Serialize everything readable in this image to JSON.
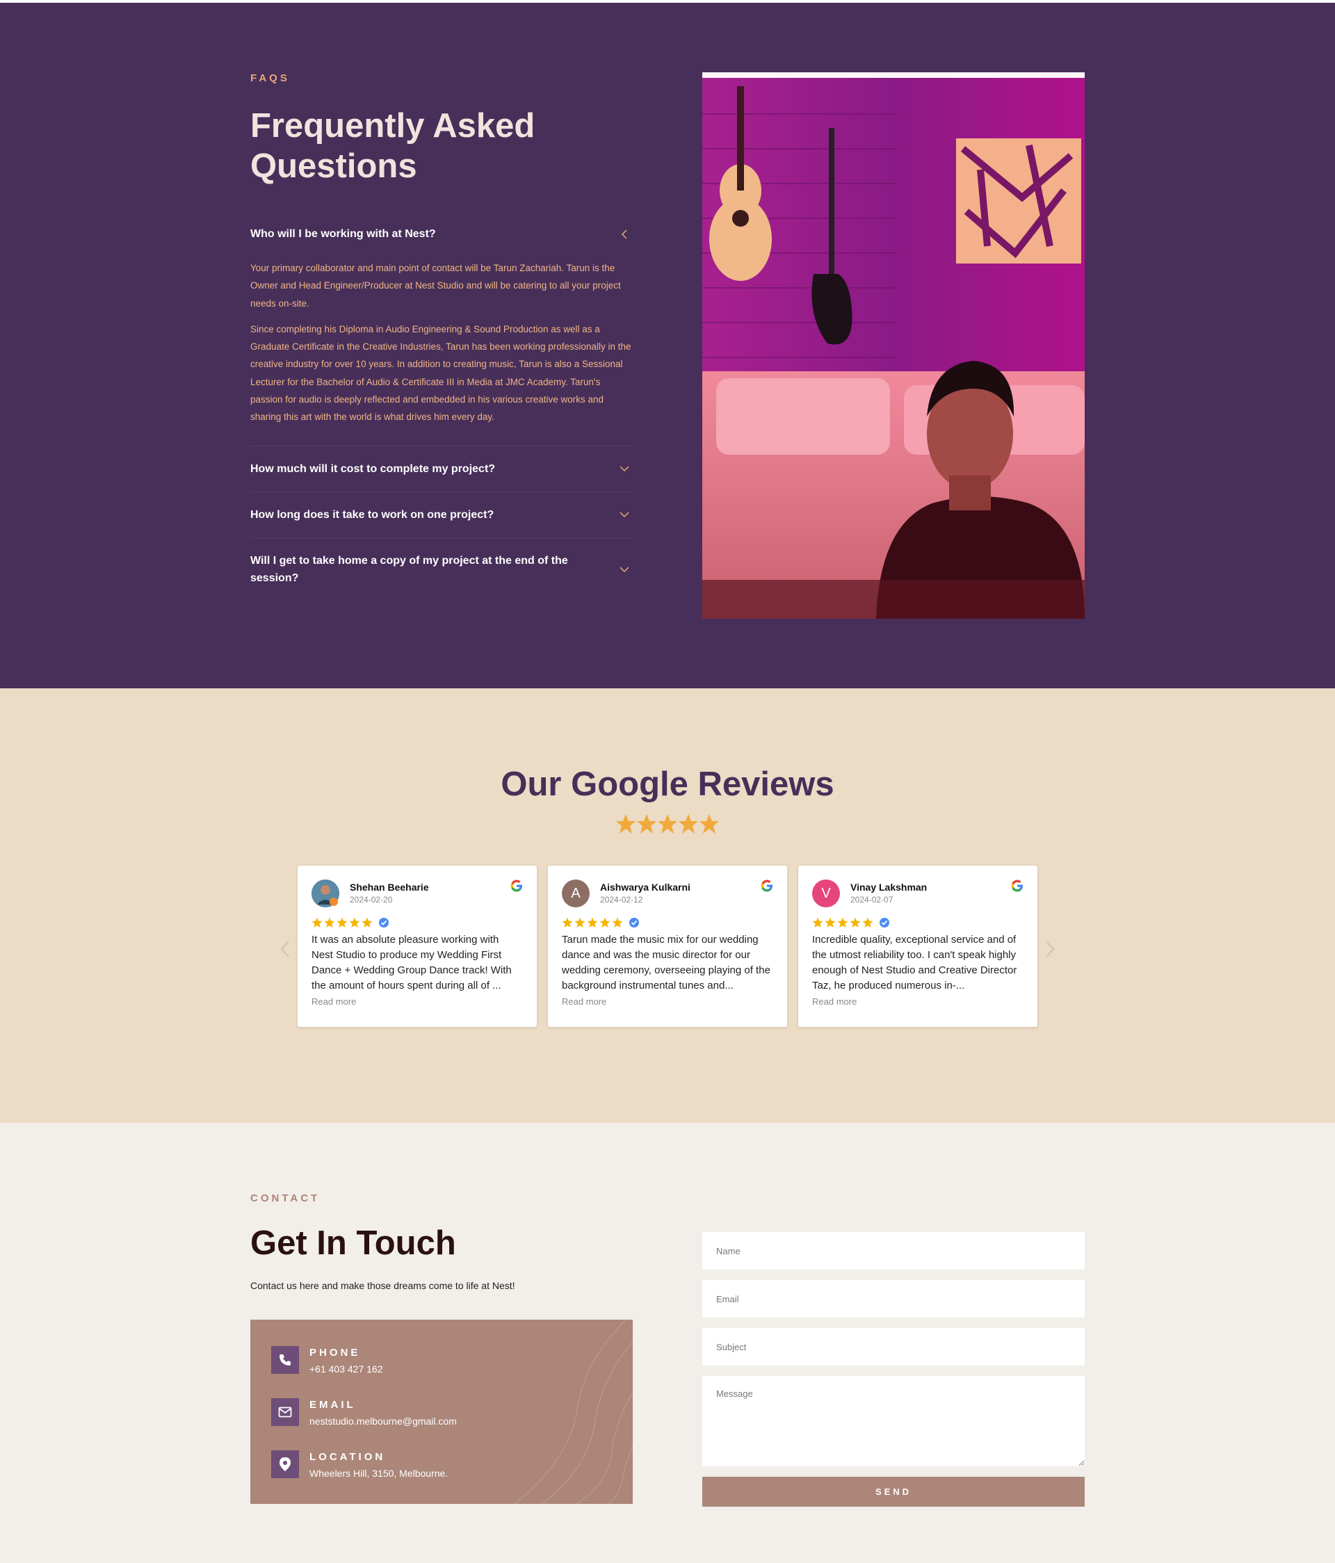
{
  "faq": {
    "eyebrow": "FAQS",
    "title": "Frequently Asked Questions",
    "items": [
      {
        "question": "Who will I be working with at Nest?",
        "open": true,
        "answer": [
          "Your primary collaborator and main point of contact will be Tarun Zachariah. Tarun is the Owner and Head Engineer/Producer at Nest Studio and will be catering to all your project needs on-site.",
          "Since completing his Diploma in Audio Engineering & Sound Production as well as a Graduate Certificate in the Creative Industries, Tarun has been working professionally in the creative industry for over 10 years. In addition to creating music, Tarun is also a Sessional Lecturer for the Bachelor of Audio & Certificate III in Media at JMC Academy. Tarun's passion for audio is deeply reflected and embedded in his various creative works and sharing this art with the world is what drives him every day."
        ]
      },
      {
        "question": "How much will it cost to complete my project?",
        "open": false
      },
      {
        "question": "How long does it take to work on one project?",
        "open": false
      },
      {
        "question": "Will I get to take home a copy of my project at the end of the session?",
        "open": false
      }
    ]
  },
  "reviews": {
    "title": "Our Google Reviews",
    "rating": 5,
    "star_color": "#f0a93b",
    "cards": [
      {
        "name": "Shehan Beeharie",
        "date": "2024-02-20",
        "avatar_letter": "",
        "avatar_color": "#3a6e8c",
        "text": "It was an absolute pleasure working with Nest Studio to produce my Wedding First Dance + Wedding Group Dance track! With the amount of hours spent during all of ...",
        "read_more": "Read more"
      },
      {
        "name": "Aishwarya Kulkarni",
        "date": "2024-02-12",
        "avatar_letter": "A",
        "avatar_color": "#8d6e63",
        "text": "Tarun made the music mix for our wedding dance and was the music director for our wedding ceremony, overseeing playing of the background instrumental tunes and...",
        "read_more": "Read more"
      },
      {
        "name": "Vinay Lakshman",
        "date": "2024-02-07",
        "avatar_letter": "V",
        "avatar_color": "#e6457a",
        "text": "Incredible quality, exceptional service and of the utmost reliability too. I can't speak highly enough of Nest Studio and Creative Director Taz, he produced numerous in-...",
        "read_more": "Read more"
      }
    ]
  },
  "contact": {
    "eyebrow": "CONTACT",
    "title": "Get In Touch",
    "subtitle": "Contact us here and make those dreams come to life at Nest!",
    "phone_label": "PHONE",
    "phone": "+61 403 427 162",
    "email_label": "EMAIL",
    "email": "neststudio.melbourne@gmail.com",
    "location_label": "LOCATION",
    "location": "Wheelers Hill, 3150, Melbourne.",
    "form": {
      "name_placeholder": "Name",
      "email_placeholder": "Email",
      "subject_placeholder": "Subject",
      "message_placeholder": "Message",
      "send_label": "SEND"
    }
  }
}
